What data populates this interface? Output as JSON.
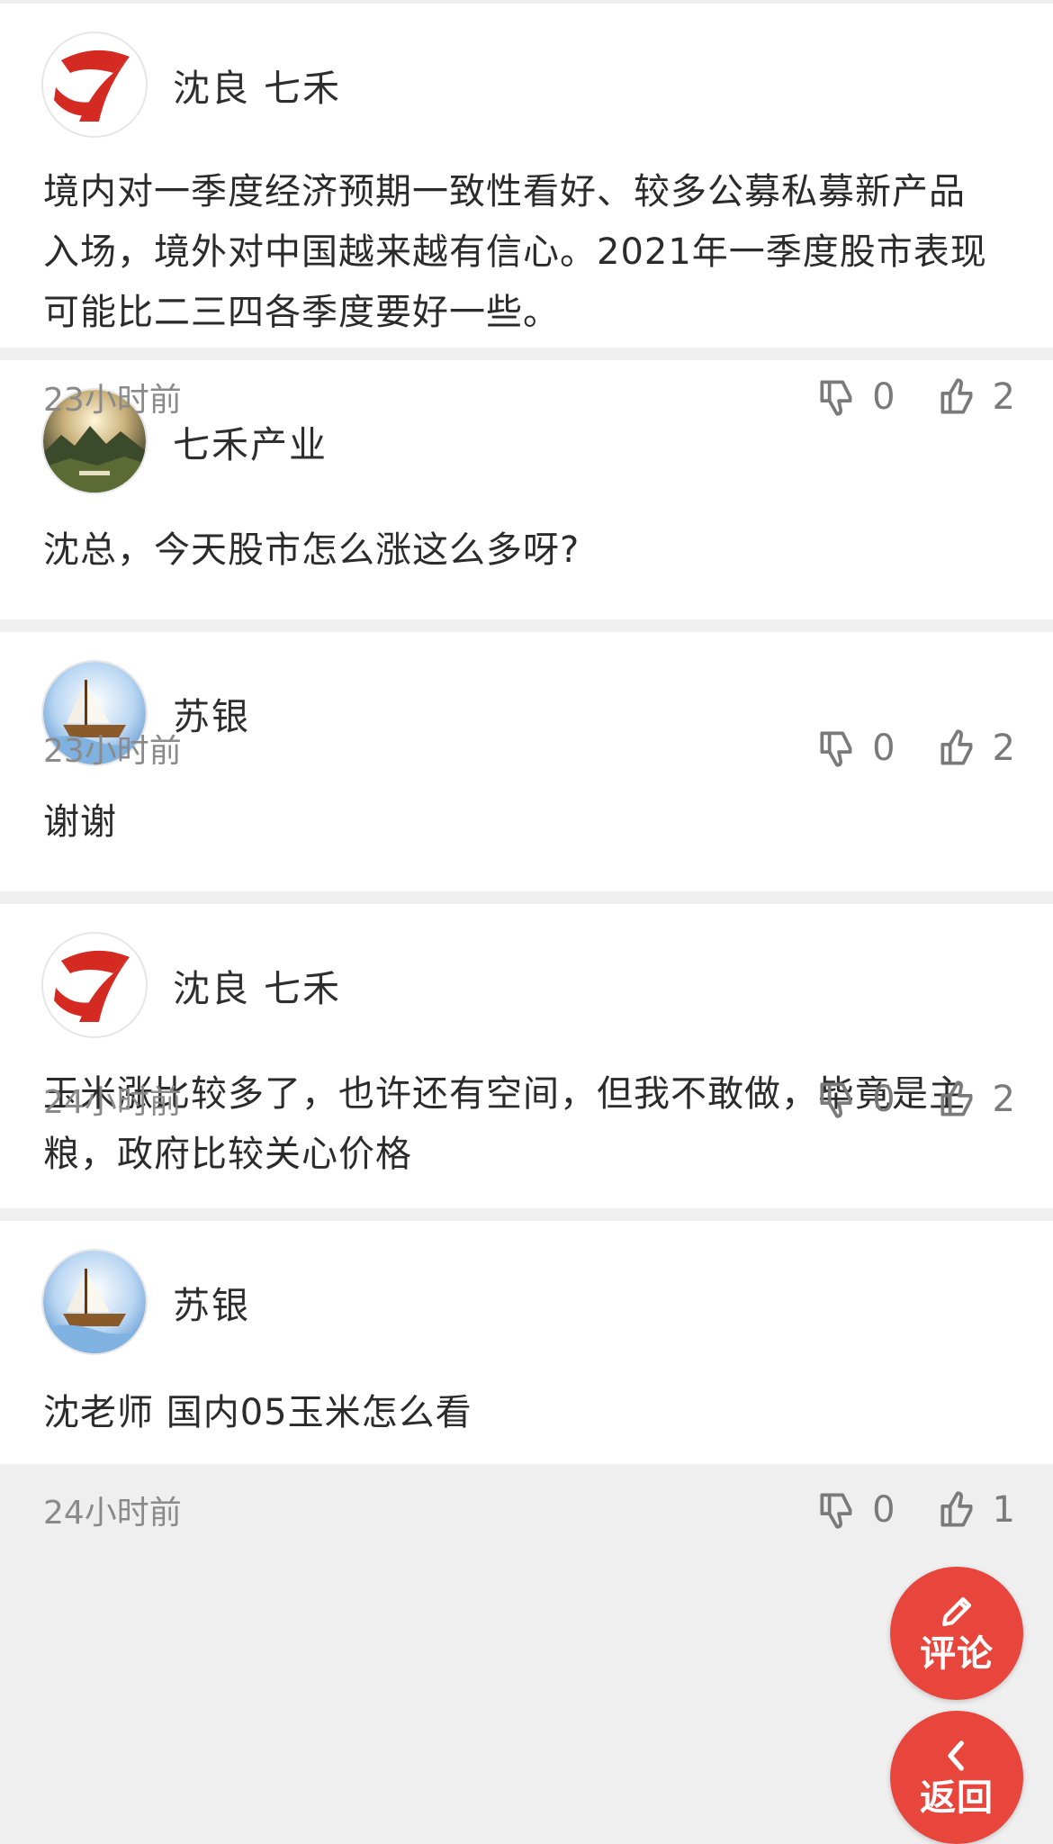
{
  "comments": [
    {
      "avatar_icon": "qihe-logo-avatar",
      "username": "沈良 七禾",
      "text": "境内对一季度经济预期一致性看好、较多公募私募新产品入场，境外对中国越来越有信心。2021年一季度股市表现可能比二三四各季度要好一些。",
      "time": "23小时前",
      "dislikes": "0",
      "likes": "2"
    },
    {
      "avatar_icon": "landscape-photo-avatar",
      "username": "七禾产业",
      "text": "沈总，今天股市怎么涨这么多呀?",
      "time": "23小时前",
      "dislikes": "0",
      "likes": "2"
    },
    {
      "avatar_icon": "sailing-ship-avatar",
      "username": "苏银",
      "text": "谢谢",
      "time": "24小时前",
      "dislikes": "0",
      "likes": "2"
    },
    {
      "avatar_icon": "qihe-logo-avatar",
      "username": "沈良 七禾",
      "text": "玉米涨比较多了，也许还有空间，但我不敢做，毕竟是主粮，政府比较关心价格",
      "time": "24小时前",
      "dislikes": "0",
      "likes": "1"
    },
    {
      "avatar_icon": "sailing-ship-avatar",
      "username": "苏银",
      "text": "沈老师 国内05玉米怎么看",
      "time": "",
      "dislikes": "",
      "likes": ""
    }
  ],
  "fab": {
    "comment_label": "评论",
    "comment_icon": "pencil-icon",
    "back_label": "返回",
    "back_icon": "chevron-left-icon",
    "color": "#e8453c"
  }
}
